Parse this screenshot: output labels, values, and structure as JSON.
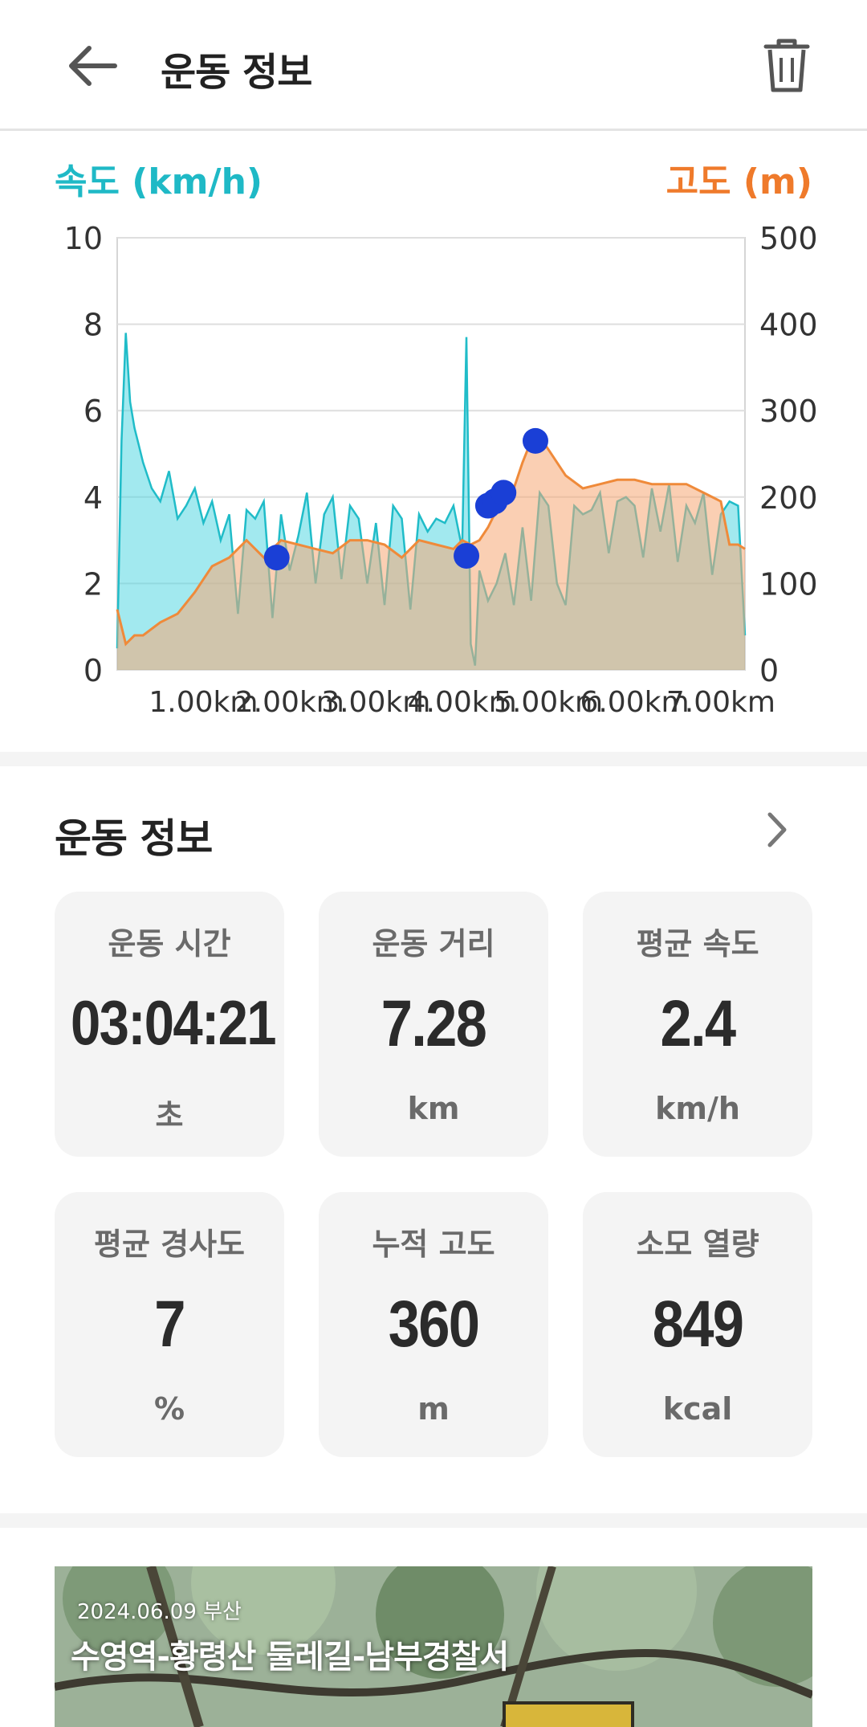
{
  "header": {
    "title": "운동 정보"
  },
  "chart_data": {
    "type": "area",
    "left_axis_label": "속도 (km/h)",
    "right_axis_label": "고도 (m)",
    "left_ylim": [
      0,
      10
    ],
    "right_ylim": [
      0,
      500
    ],
    "left_ticks": [
      "10",
      "8",
      "6",
      "4",
      "2",
      "0"
    ],
    "right_ticks": [
      "500",
      "400",
      "300",
      "200",
      "100",
      "0"
    ],
    "x_ticks": [
      "1.00km",
      "2.00km",
      "3.00km",
      "4.00km",
      "5.00km",
      "6.00km",
      "7.00km"
    ],
    "grid": true,
    "speed_color": "#45d3df",
    "altitude_color": "#ef8a3a",
    "marker_color": "#1a3fd6",
    "series": [
      {
        "name": "속도 (km/h)",
        "x": [
          0,
          0.05,
          0.1,
          0.15,
          0.2,
          0.25,
          0.3,
          0.35,
          0.4,
          0.5,
          0.6,
          0.7,
          0.8,
          0.9,
          1.0,
          1.1,
          1.2,
          1.3,
          1.4,
          1.5,
          1.6,
          1.7,
          1.8,
          1.9,
          2.0,
          2.1,
          2.2,
          2.3,
          2.4,
          2.5,
          2.6,
          2.7,
          2.8,
          2.9,
          3.0,
          3.1,
          3.2,
          3.3,
          3.4,
          3.5,
          3.6,
          3.7,
          3.8,
          3.9,
          4.0,
          4.05,
          4.1,
          4.15,
          4.2,
          4.3,
          4.4,
          4.5,
          4.6,
          4.7,
          4.8,
          4.9,
          5.0,
          5.1,
          5.2,
          5.3,
          5.4,
          5.5,
          5.6,
          5.7,
          5.8,
          5.9,
          6.0,
          6.1,
          6.2,
          6.3,
          6.4,
          6.5,
          6.6,
          6.7,
          6.8,
          6.9,
          7.0,
          7.1,
          7.2,
          7.28
        ],
        "values": [
          0.5,
          5.3,
          7.8,
          6.2,
          5.6,
          5.2,
          4.8,
          4.5,
          4.2,
          3.9,
          4.6,
          3.5,
          3.8,
          4.2,
          3.4,
          3.9,
          3.0,
          3.6,
          1.3,
          3.7,
          3.5,
          3.9,
          1.2,
          3.6,
          2.3,
          3.1,
          4.1,
          2.0,
          3.6,
          4.0,
          2.1,
          3.8,
          3.5,
          2.0,
          3.4,
          1.5,
          3.8,
          3.5,
          1.4,
          3.6,
          3.2,
          3.5,
          3.4,
          3.8,
          2.8,
          7.7,
          0.6,
          0.1,
          2.3,
          1.6,
          2.0,
          2.7,
          1.5,
          3.3,
          1.6,
          4.1,
          3.8,
          2.0,
          1.5,
          3.8,
          3.6,
          3.7,
          4.1,
          2.7,
          3.9,
          4.0,
          3.8,
          2.6,
          4.2,
          3.2,
          4.3,
          2.5,
          3.8,
          3.4,
          4.1,
          2.2,
          3.6,
          3.9,
          3.8,
          0.8
        ]
      },
      {
        "name": "고도 (m)",
        "x": [
          0,
          0.1,
          0.2,
          0.3,
          0.5,
          0.7,
          0.9,
          1.1,
          1.3,
          1.5,
          1.7,
          1.9,
          2.1,
          2.3,
          2.5,
          2.7,
          2.9,
          3.1,
          3.3,
          3.5,
          3.7,
          3.9,
          4.0,
          4.1,
          4.2,
          4.3,
          4.4,
          4.5,
          4.6,
          4.7,
          4.8,
          4.9,
          5.0,
          5.2,
          5.4,
          5.6,
          5.8,
          6.0,
          6.2,
          6.4,
          6.6,
          6.8,
          7.0,
          7.1,
          7.2,
          7.28
        ],
        "values": [
          70,
          30,
          40,
          40,
          55,
          65,
          90,
          120,
          130,
          150,
          130,
          150,
          145,
          140,
          135,
          150,
          150,
          145,
          130,
          150,
          145,
          140,
          150,
          145,
          150,
          165,
          185,
          200,
          210,
          240,
          265,
          270,
          255,
          225,
          210,
          215,
          220,
          220,
          215,
          215,
          215,
          205,
          195,
          145,
          145,
          140
        ]
      }
    ],
    "markers_km": [
      1.85,
      4.05,
      4.3,
      4.38,
      4.48,
      4.85
    ],
    "markers_alt": [
      130,
      132,
      190,
      195,
      205,
      265
    ]
  },
  "stats": {
    "title": "운동 정보",
    "cards": [
      {
        "label": "운동 시간",
        "value": "03:04:21",
        "unit": "초"
      },
      {
        "label": "운동 거리",
        "value": "7.28",
        "unit": "km"
      },
      {
        "label": "평균 속도",
        "value": "2.4",
        "unit": "km/h"
      },
      {
        "label": "평균 경사도",
        "value": "7",
        "unit": "%"
      },
      {
        "label": "누적 고도",
        "value": "360",
        "unit": "m"
      },
      {
        "label": "소모 열량",
        "value": "849",
        "unit": "kcal"
      }
    ]
  },
  "photo": {
    "date_location": "2024.06.09  부산",
    "title": "수영역-황령산 둘레길-남부경찰서"
  }
}
